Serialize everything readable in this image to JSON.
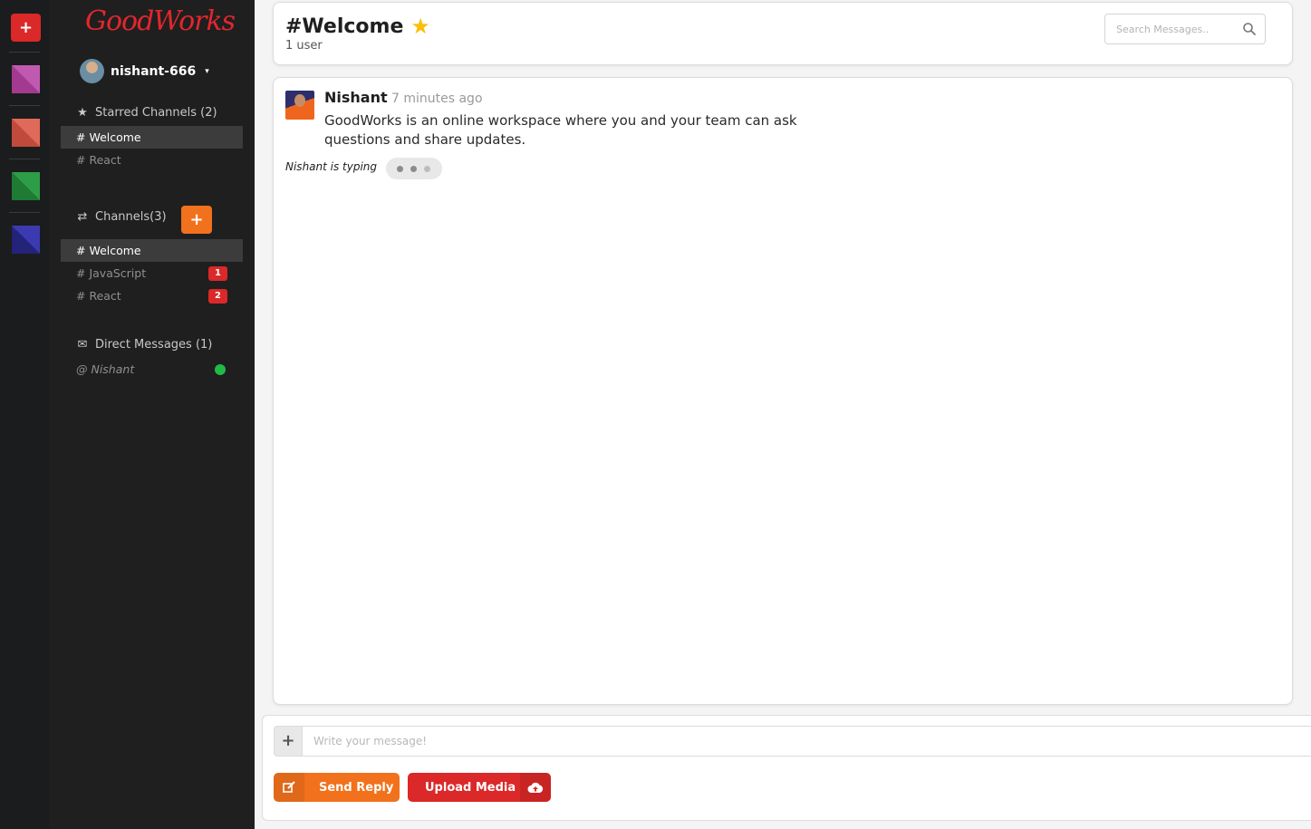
{
  "app": {
    "logo": "GoodWorks"
  },
  "strip": {
    "add_label": "+",
    "swatches": [
      {
        "color_a": "#c05ab0",
        "color_b": "#a23b8f",
        "icon": "purple-color-swatch"
      },
      {
        "color_a": "#e06a5a",
        "color_b": "#c04a3b",
        "icon": "red-color-swatch"
      },
      {
        "color_a": "#2e9d47",
        "color_b": "#1f7a33",
        "icon": "green-color-swatch"
      },
      {
        "color_a": "#3b3ab0",
        "color_b": "#23237a",
        "icon": "blue-color-swatch"
      }
    ]
  },
  "sidebar": {
    "user": {
      "name": "nishant-666",
      "caret": "▾"
    },
    "starred": {
      "title": "Starred Channels (2)",
      "items": [
        {
          "label": "# Welcome",
          "active": true
        },
        {
          "label": "# React",
          "active": false
        }
      ]
    },
    "channels": {
      "title": "Channels(3)",
      "add_label": "+",
      "items": [
        {
          "label": "# Welcome",
          "active": true,
          "badge": ""
        },
        {
          "label": "# JavaScript",
          "active": false,
          "badge": "1"
        },
        {
          "label": "# React",
          "active": false,
          "badge": "2"
        }
      ]
    },
    "direct": {
      "title": "Direct Messages (1)",
      "items": [
        {
          "label": "@ Nishant",
          "status": "online"
        }
      ]
    }
  },
  "header": {
    "title": "#Welcome",
    "user_count": "1 user",
    "starred": true,
    "search_placeholder": "Search Messages.."
  },
  "messages": [
    {
      "author": "Nishant",
      "time": "7 minutes ago",
      "text": "GoodWorks is an online workspace where you and your team can ask questions and share updates."
    }
  ],
  "typing": {
    "text": "Nishant is typing"
  },
  "form": {
    "attach_label": "+",
    "placeholder": "Write your message!",
    "value": "",
    "send_label": "Send Reply",
    "upload_label": "Upload Media"
  },
  "colors": {
    "accent_orange": "#f2711c",
    "accent_red": "#db2828",
    "brand_red": "#e3262d",
    "star_yellow": "#fbbd08",
    "online_green": "#21ba45"
  }
}
